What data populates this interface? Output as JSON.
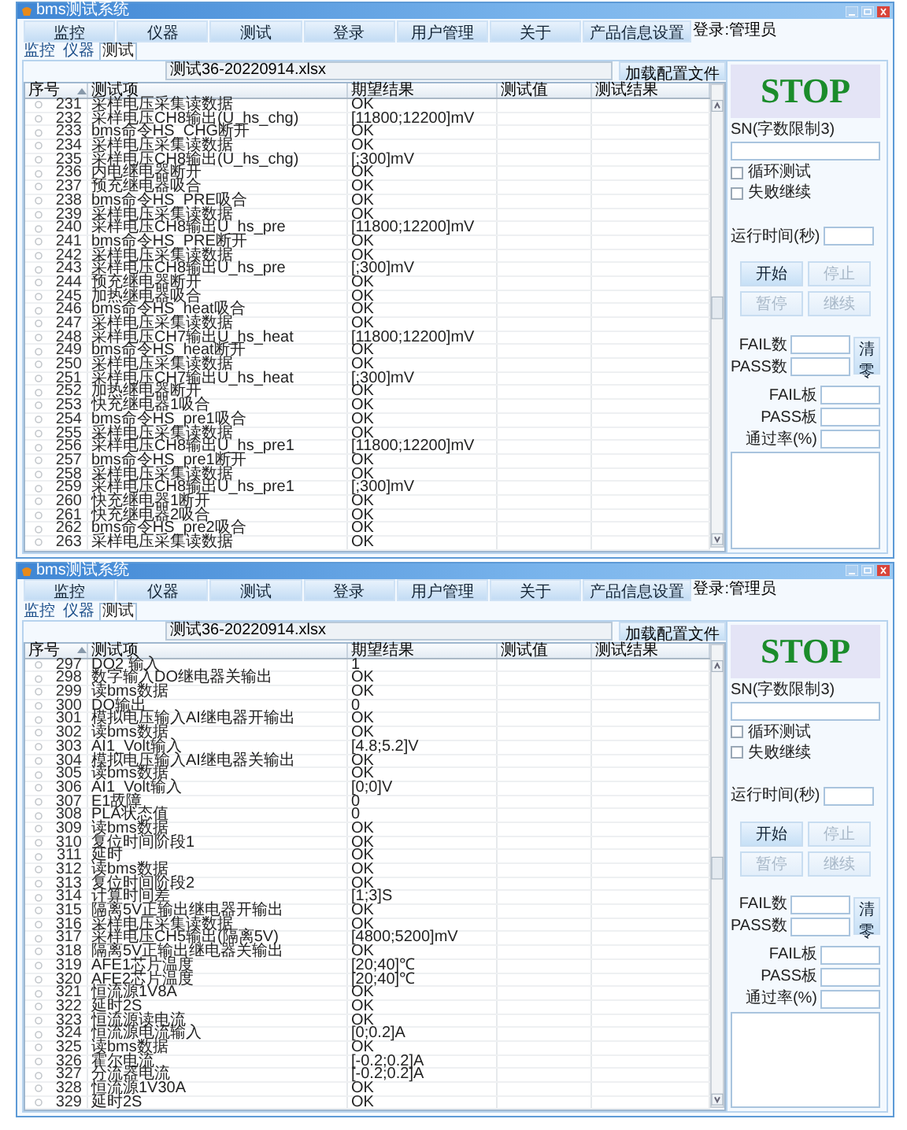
{
  "windows": [
    {
      "title": "bms测试系统",
      "menu": [
        "监控",
        "仪器",
        "测试",
        "登录",
        "用户管理",
        "关于",
        "产品信息设置"
      ],
      "user": "登录:管理员",
      "tabs": [
        {
          "label": "监控",
          "selected": false
        },
        {
          "label": "仪器",
          "selected": false
        },
        {
          "label": "测试",
          "selected": true
        }
      ],
      "file_name": "测试36-20220914.xlsx",
      "load_button": "加载配置文件",
      "table": {
        "columns": [
          "序号",
          "测试项",
          "期望结果",
          "测试值",
          "测试结果"
        ],
        "rows": [
          {
            "cells": [
              "231",
              "采样电压采集读数据",
              "OK"
            ]
          },
          {
            "cells": [
              "232",
              "采样电压CH8输出(U_hs_chg)",
              "[11800;12200]mV"
            ]
          },
          {
            "cells": [
              "233",
              "bms命令HS_CHG断开",
              "OK"
            ]
          },
          {
            "cells": [
              "234",
              "采样电压采集读数据",
              "OK"
            ]
          },
          {
            "cells": [
              "235",
              "采样电压CH8输出(U_hs_chg)",
              "[;300]mV"
            ]
          },
          {
            "cells": [
              "236",
              "内电继电器断开",
              "OK"
            ]
          },
          {
            "cells": [
              "237",
              "预充继电器吸合",
              "OK"
            ]
          },
          {
            "cells": [
              "238",
              "bms命令HS_PRE吸合",
              "OK"
            ]
          },
          {
            "cells": [
              "239",
              "采样电压采集读数据",
              "OK"
            ]
          },
          {
            "cells": [
              "240",
              "采样电压CH8输出U_hs_pre",
              "[11800;12200]mV"
            ]
          },
          {
            "cells": [
              "241",
              "bms命令HS_PRE断开",
              "OK"
            ]
          },
          {
            "cells": [
              "242",
              "采样电压采集读数据",
              "OK"
            ]
          },
          {
            "cells": [
              "243",
              "采样电压CH8输出U_hs_pre",
              "[;300]mV"
            ]
          },
          {
            "cells": [
              "244",
              "预充继电器断开",
              "OK"
            ]
          },
          {
            "cells": [
              "245",
              "加热继电器吸合",
              "OK"
            ]
          },
          {
            "cells": [
              "246",
              "bms命令HS_heat吸合",
              "OK"
            ]
          },
          {
            "cells": [
              "247",
              "采样电压采集读数据",
              "OK"
            ]
          },
          {
            "cells": [
              "248",
              "采样电压CH7输出U_hs_heat",
              "[11800;12200]mV"
            ]
          },
          {
            "cells": [
              "249",
              "bms命令HS_heat断开",
              "OK"
            ]
          },
          {
            "cells": [
              "250",
              "采样电压采集读数据",
              "OK"
            ]
          },
          {
            "cells": [
              "251",
              "采样电压CH7输出U_hs_heat",
              "[;300]mV"
            ]
          },
          {
            "cells": [
              "252",
              "加热继电器断开",
              "OK"
            ]
          },
          {
            "cells": [
              "253",
              "快充继电器1吸合",
              "OK"
            ]
          },
          {
            "cells": [
              "254",
              "bms命令HS_pre1吸合",
              "OK"
            ]
          },
          {
            "cells": [
              "255",
              "采样电压采集读数据",
              "OK"
            ]
          },
          {
            "cells": [
              "256",
              "采样电压CH8输出U_hs_pre1",
              "[11800;12200]mV"
            ]
          },
          {
            "cells": [
              "257",
              "bms命令HS_pre1断开",
              "OK"
            ]
          },
          {
            "cells": [
              "258",
              "采样电压采集读数据",
              "OK"
            ]
          },
          {
            "cells": [
              "259",
              "采样电压CH8输出U_hs_pre1",
              "[;300]mV"
            ]
          },
          {
            "cells": [
              "260",
              "快充继电器1断开",
              "OK"
            ]
          },
          {
            "cells": [
              "261",
              "快充继电器2吸合",
              "OK"
            ]
          },
          {
            "cells": [
              "262",
              "bms命令HS_pre2吸合",
              "OK"
            ]
          },
          {
            "cells": [
              "263",
              "采样电压采集读数据",
              "OK"
            ]
          }
        ]
      },
      "panel": {
        "stop": "STOP",
        "sn_label": "SN(字数限制3)",
        "checkboxes": [
          {
            "label": "循环测试",
            "checked": false
          },
          {
            "label": "失败继续",
            "checked": false
          }
        ],
        "runtime_label": "运行时间(秒)",
        "buttons": [
          {
            "label": "开始",
            "disabled": false
          },
          {
            "label": "停止",
            "disabled": true
          },
          {
            "label": "暂停",
            "disabled": true
          },
          {
            "label": "继续",
            "disabled": true
          }
        ],
        "counts": [
          "FAIL数",
          "PASS数"
        ],
        "clear_button": "清零",
        "boards": [
          "FAIL板",
          "PASS板",
          "通过率(%)"
        ]
      }
    },
    {
      "title": "bms测试系统",
      "menu": [
        "监控",
        "仪器",
        "测试",
        "登录",
        "用户管理",
        "关于",
        "产品信息设置"
      ],
      "user": "登录:管理员",
      "tabs": [
        {
          "label": "监控",
          "selected": false
        },
        {
          "label": "仪器",
          "selected": false
        },
        {
          "label": "测试",
          "selected": true
        }
      ],
      "file_name": "测试36-20220914.xlsx",
      "load_button": "加载配置文件",
      "table": {
        "columns": [
          "序号",
          "测试项",
          "期望结果",
          "测试值",
          "测试结果"
        ],
        "rows": [
          {
            "cells": [
              "297",
              "DO2 输入",
              "1"
            ]
          },
          {
            "cells": [
              "298",
              "数字输入DO继电器关输出",
              "OK"
            ]
          },
          {
            "cells": [
              "299",
              "读bms数据",
              "OK"
            ]
          },
          {
            "cells": [
              "300",
              "DO输出",
              "0"
            ]
          },
          {
            "cells": [
              "301",
              "模拟电压输入AI继电器开输出",
              "OK"
            ]
          },
          {
            "cells": [
              "302",
              "读bms数据",
              "OK"
            ]
          },
          {
            "cells": [
              "303",
              "AI1_Volt输入",
              "[4.8;5.2]V"
            ]
          },
          {
            "cells": [
              "304",
              "模拟电压输入AI继电器关输出",
              "OK"
            ]
          },
          {
            "cells": [
              "305",
              "读bms数据",
              "OK"
            ]
          },
          {
            "cells": [
              "306",
              "AI1_Volt输入",
              "[0;0]V"
            ]
          },
          {
            "cells": [
              "307",
              "E1故障",
              "0"
            ]
          },
          {
            "cells": [
              "308",
              "PLA状态值",
              "0"
            ]
          },
          {
            "cells": [
              "309",
              "读bms数据",
              "OK"
            ]
          },
          {
            "cells": [
              "310",
              "复位时间阶段1",
              "OK"
            ]
          },
          {
            "cells": [
              "311",
              "延时",
              "OK"
            ]
          },
          {
            "cells": [
              "312",
              "读bms数据",
              "OK"
            ]
          },
          {
            "cells": [
              "313",
              "复位时间阶段2",
              "OK"
            ]
          },
          {
            "cells": [
              "314",
              "计算时间差",
              "[1;3]S"
            ]
          },
          {
            "cells": [
              "315",
              "隔离5V正输出继电器开输出",
              "OK"
            ]
          },
          {
            "cells": [
              "316",
              "采样电压采集读数据",
              "OK"
            ]
          },
          {
            "cells": [
              "317",
              "采样电压CH5输出(隔离5V)",
              "[4800;5200]mV"
            ]
          },
          {
            "cells": [
              "318",
              "隔离5V正输出继电器关输出",
              "OK"
            ]
          },
          {
            "cells": [
              "319",
              "AFE1芯片温度",
              "[20;40]℃"
            ]
          },
          {
            "cells": [
              "320",
              "AFE2芯片温度",
              "[20;40]℃"
            ]
          },
          {
            "cells": [
              "321",
              "恒流源1V8A",
              "OK"
            ]
          },
          {
            "cells": [
              "322",
              "延时2S",
              "OK"
            ]
          },
          {
            "cells": [
              "323",
              "恒流源读电流",
              "OK"
            ]
          },
          {
            "cells": [
              "324",
              "恒流源电流输入",
              "[0;0.2]A"
            ]
          },
          {
            "cells": [
              "325",
              "读bms数据",
              "OK"
            ]
          },
          {
            "cells": [
              "326",
              "霍尔电流",
              "[-0.2;0.2]A"
            ]
          },
          {
            "cells": [
              "327",
              "分流器电流",
              "[-0.2;0.2]A"
            ]
          },
          {
            "cells": [
              "328",
              "恒流源1V30A",
              "OK"
            ]
          },
          {
            "cells": [
              "329",
              "延时2S",
              "OK"
            ]
          }
        ]
      },
      "panel": {
        "stop": "STOP",
        "sn_label": "SN(字数限制3)",
        "checkboxes": [
          {
            "label": "循环测试",
            "checked": false
          },
          {
            "label": "失败继续",
            "checked": false
          }
        ],
        "runtime_label": "运行时间(秒)",
        "buttons": [
          {
            "label": "开始",
            "disabled": false
          },
          {
            "label": "停止",
            "disabled": true
          },
          {
            "label": "暂停",
            "disabled": true
          },
          {
            "label": "继续",
            "disabled": true
          }
        ],
        "counts": [
          "FAIL数",
          "PASS数"
        ],
        "clear_button": "清零",
        "boards": [
          "FAIL板",
          "PASS板",
          "通过率(%)"
        ]
      }
    }
  ]
}
